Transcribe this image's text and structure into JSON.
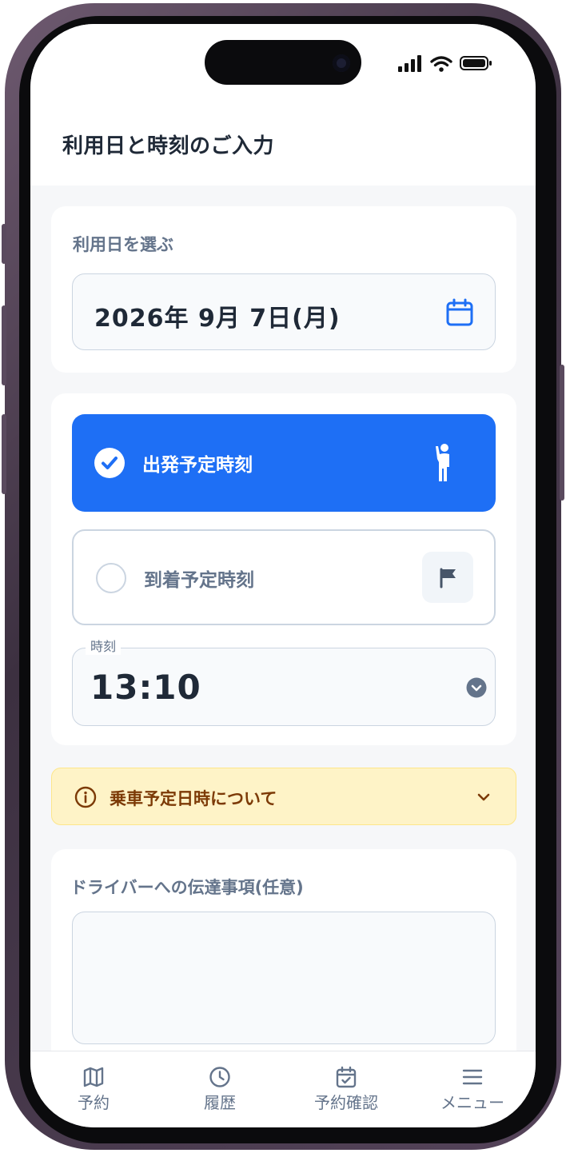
{
  "header": {
    "title": "利用日と時刻のご入力"
  },
  "date_section": {
    "label": "利用日を選ぶ",
    "value": "2026年 9月 7日(月)"
  },
  "time_section": {
    "options": [
      {
        "label": "出発予定時刻",
        "selected": true
      },
      {
        "label": "到着予定時刻",
        "selected": false
      }
    ],
    "time_label": "時刻",
    "time_value": "13:10"
  },
  "info_banner": {
    "text": "乗車予定日時について"
  },
  "note_section": {
    "label": "ドライバーへの伝達事項(任意)",
    "value": ""
  },
  "tabs": [
    {
      "label": "予約",
      "icon": "map-icon"
    },
    {
      "label": "履歴",
      "icon": "clock-icon"
    },
    {
      "label": "予約確認",
      "icon": "calendar-check-icon"
    },
    {
      "label": "メニュー",
      "icon": "menu-icon"
    }
  ],
  "colors": {
    "primary": "#1e6ff5",
    "text_dark": "#1f2937",
    "text_muted": "#64748b",
    "warning_bg": "#fef3c7",
    "warning_text": "#7c3a06"
  }
}
